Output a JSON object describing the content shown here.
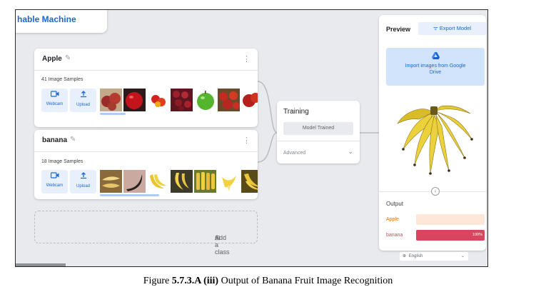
{
  "app": {
    "title_fragment": "hable Machine"
  },
  "classes": [
    {
      "name": "Apple",
      "samples": "41 Image Samples",
      "webcam_label": "Webcam",
      "upload_label": "Upload"
    },
    {
      "name": "banana",
      "samples": "18 Image Samples",
      "webcam_label": "Webcam",
      "upload_label": "Upload"
    }
  ],
  "add_class_label": "Add a class",
  "training": {
    "title": "Training",
    "button_label": "Model Trained",
    "advanced_label": "Advanced"
  },
  "preview": {
    "title": "Preview",
    "export_label": "Export Model",
    "import_label": "Import images from Google Drive",
    "output_label": "Output",
    "outputs": [
      {
        "label": "Apple",
        "percent": 0,
        "percent_text": "",
        "color": "#e8710a",
        "track": "#fde7d8"
      },
      {
        "label": "banana",
        "percent": 100,
        "percent_text": "100%",
        "color": "#d9445e",
        "track": "#f6d6dc"
      }
    ]
  },
  "language_select": "English",
  "caption": {
    "prefix": "Figure ",
    "bold": "5.7.3.A (iii)",
    "suffix": " Output of Banana Fruit Image Recognition"
  },
  "colors": {
    "accent": "#1967d2",
    "canvas": "#e8eaed"
  }
}
